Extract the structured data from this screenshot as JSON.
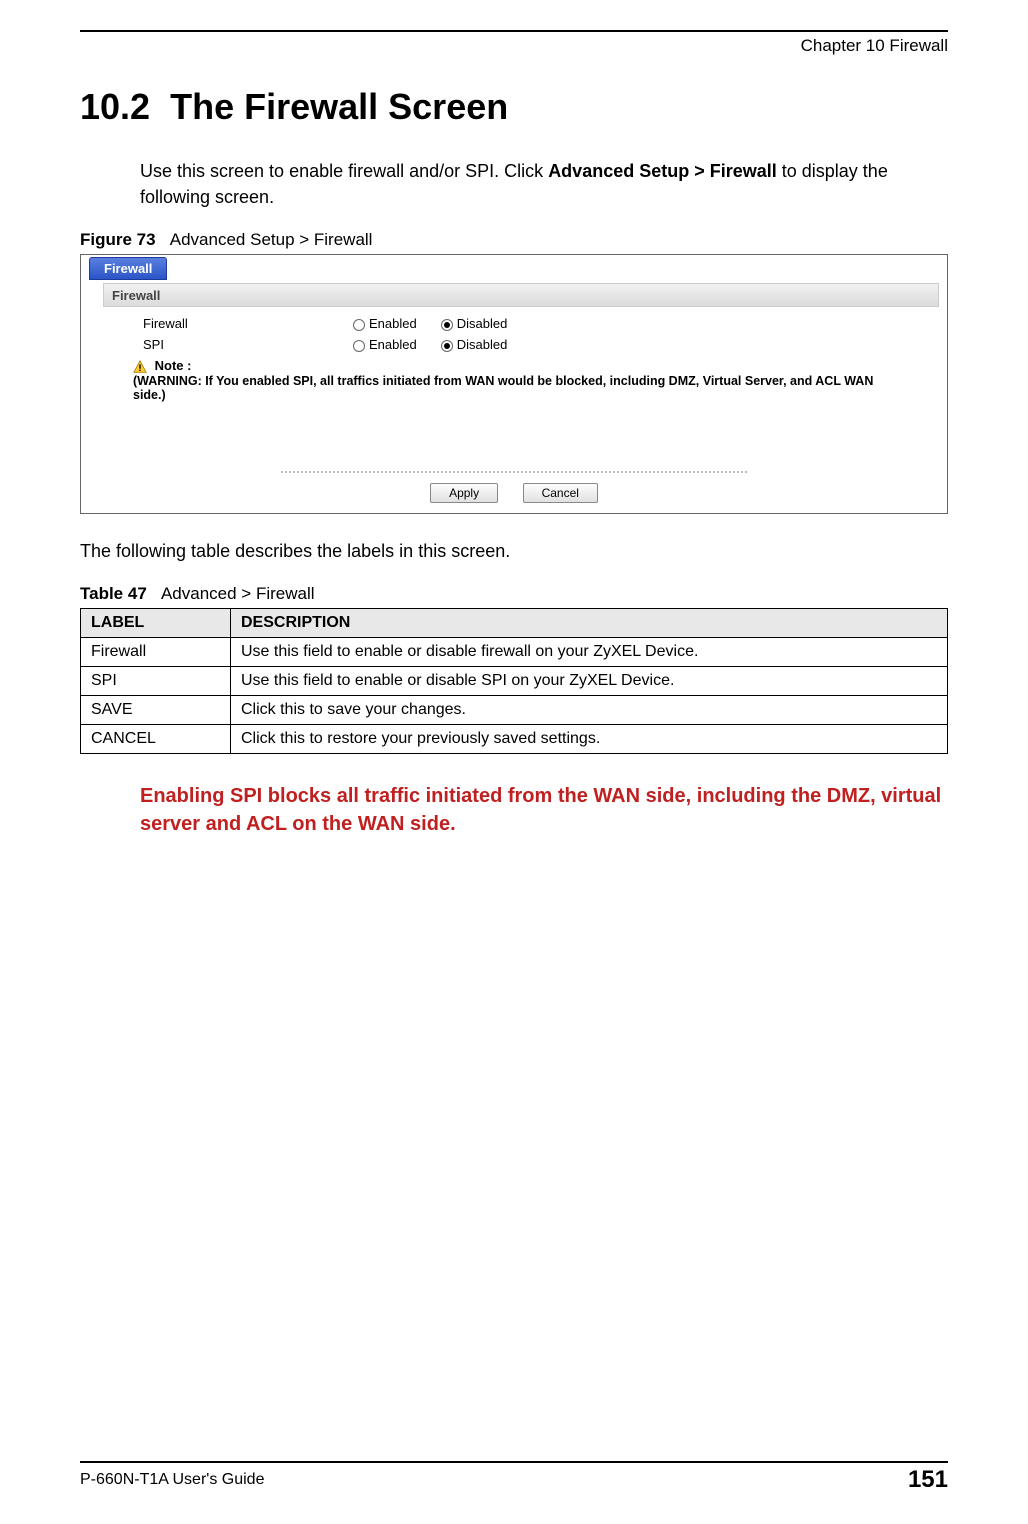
{
  "header": {
    "chapter": "Chapter 10 Firewall"
  },
  "section": {
    "number": "10.2",
    "title": "The Firewall Screen"
  },
  "intro": {
    "text_part1": "Use this screen to enable firewall and/or SPI. Click ",
    "bold": "Advanced Setup > Firewall",
    "text_part2": " to display the following screen."
  },
  "figure": {
    "label": "Figure 73",
    "caption": "Advanced Setup > Firewall",
    "tab": "Firewall",
    "panel_title": "Firewall",
    "rows": [
      {
        "label": "Firewall",
        "enabled": "Enabled",
        "disabled": "Disabled",
        "selected": "disabled"
      },
      {
        "label": "SPI",
        "enabled": "Enabled",
        "disabled": "Disabled",
        "selected": "disabled"
      }
    ],
    "note_label": "Note :",
    "warning": "(WARNING: If You enabled SPI, all traffics initiated from WAN would be blocked, including DMZ, Virtual Server, and ACL WAN side.)",
    "buttons": {
      "apply": "Apply",
      "cancel": "Cancel"
    }
  },
  "table_intro": "The following table describes the labels in this screen.",
  "table": {
    "label": "Table 47",
    "caption": "Advanced > Firewall",
    "headers": {
      "label": "LABEL",
      "description": "DESCRIPTION"
    },
    "rows": [
      {
        "label": "Firewall",
        "description": "Use this field to enable or disable firewall on your ZyXEL Device."
      },
      {
        "label": "SPI",
        "description": "Use this field to enable or disable SPI on your ZyXEL Device."
      },
      {
        "label": "SAVE",
        "description": "Click this to save your changes."
      },
      {
        "label": "CANCEL",
        "description": "Click this to restore your previously saved settings."
      }
    ]
  },
  "callout": "Enabling SPI blocks all traffic initiated from the WAN side, including the DMZ, virtual server and ACL on the WAN side.",
  "footer": {
    "guide": "P-660N-T1A User's Guide",
    "page": "151"
  }
}
